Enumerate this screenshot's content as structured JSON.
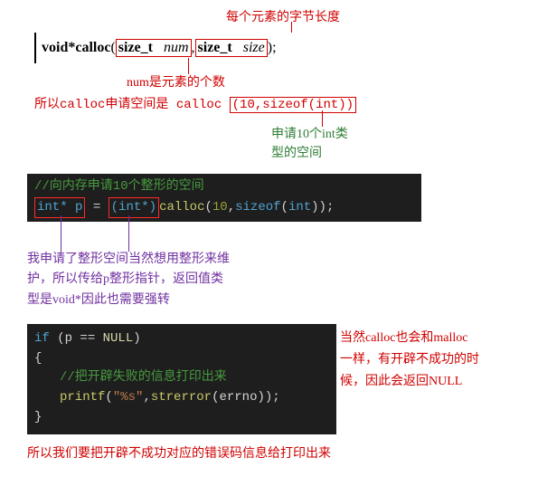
{
  "top_note": "每个元素的字节长度",
  "signature": {
    "ret": "void",
    "star": " *",
    "fn": "calloc",
    "p1_type": "size_t",
    "p1_name": "num",
    "p2_type": "size_t",
    "p2_name": "size",
    "open": "( ",
    "close": " );",
    "comma": ", "
  },
  "num_note": "num是元素的个数",
  "calloc_line_prefix": "所以calloc申请空间是",
  "calloc_call_fn": "calloc",
  "calloc_call_args": "(10,sizeof(int))",
  "apply_note_l1": "申请10个int类",
  "apply_note_l2": "型的空间",
  "code1": {
    "comment": "//向内存申请10个整形的空间",
    "l2_a": "int* p",
    "l2_eq": " = ",
    "l2_b": "(int*)",
    "l2_c": "calloc",
    "l2_d": "(",
    "l2_e": "10",
    "l2_f": ",",
    "l2_g": "sizeof",
    "l2_h": "(",
    "l2_i": "int",
    "l2_j": "));"
  },
  "mid_note_l1": "我申请了整形空间当然想用整形来维",
  "mid_note_l2": "护，所以传给p整形指针，返回值类",
  "mid_note_l3": "型是void*因此也需要强转",
  "code2": {
    "l1_a": "if",
    "l1_b": " (p == ",
    "l1_c": "NULL",
    "l1_d": ")",
    "l2": "{",
    "comment": "//把开辟失败的信息打印出来",
    "l4_a": "printf",
    "l4_b": "(",
    "l4_c": "\"%s\"",
    "l4_d": ",",
    "l4_e": "strerror",
    "l4_f": "(errno));",
    "l5": "}"
  },
  "side_note_l1": "当然calloc也会和malloc",
  "side_note_l2": "一样，有开辟不成功的时",
  "side_note_l3": "候，因此会返回NULL",
  "bottom_note": "所以我们要把开辟不成功对应的错误码信息给打印出来"
}
